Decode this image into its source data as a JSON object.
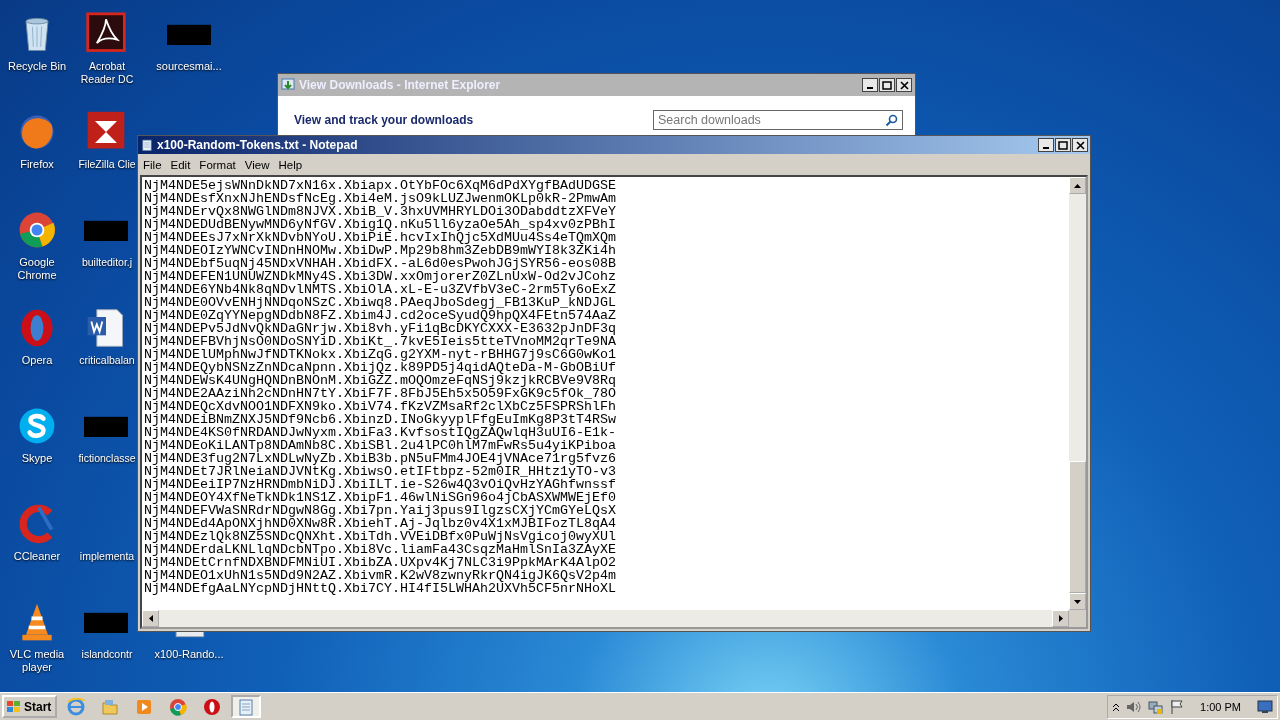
{
  "icon_columns": [
    [
      {
        "label": "Recycle Bin",
        "kind": "recycle-bin"
      },
      {
        "label": "Firefox",
        "kind": "firefox"
      },
      {
        "label": "Google Chrome",
        "kind": "chrome"
      },
      {
        "label": "Opera",
        "kind": "opera"
      },
      {
        "label": "Skype",
        "kind": "skype"
      },
      {
        "label": "CCleaner",
        "kind": "ccleaner"
      },
      {
        "label": "VLC media player",
        "kind": "vlc"
      }
    ],
    [
      {
        "label": "Acrobat Reader DC",
        "kind": "acrobat"
      },
      {
        "label": "FileZilla Clie",
        "kind": "filezilla"
      },
      {
        "label": "builteditor.j",
        "kind": "redacted"
      },
      {
        "label": "criticalbalan",
        "kind": "word"
      },
      {
        "label": "fictionclasse",
        "kind": "redacted"
      },
      {
        "label": "implementa",
        "kind": "none"
      },
      {
        "label": "islandcontr",
        "kind": "redacted"
      }
    ],
    [
      {
        "label": "sourcesmai...",
        "kind": "redacted"
      },
      {
        "label": "x100-Rando...",
        "kind": "notepad-file"
      }
    ]
  ],
  "ie_window": {
    "title": "View Downloads - Internet Explorer",
    "heading": "View and track your downloads",
    "search": {
      "placeholder": "Search downloads"
    }
  },
  "notepad": {
    "title": "x100-Random-Tokens.txt - Notepad",
    "menu": [
      "File",
      "Edit",
      "Format",
      "View",
      "Help"
    ],
    "lines": [
      "NjM4NDE5ejsWNnDkND7xN16x.Xbiapx.OtYbFOc6XqM6dPdXYgfBAdUDGSE",
      "NjM4NDEsfXnxNJhENDsfNcEg.Xbi4eM.jsO9kLUZJwenmOKLp0kR-2PmwAm",
      "NjM4NDErvQx8NWGlNDm8NJVX.XbiB_V.3hxUVMHRYLDOi3ODabddtzXFVeY",
      "NjM4NDEDUdBENywMND6yNfGV.Xbig1Q.nKu5ll6yzaOe5Ah_sp4xv0zPBhI",
      "NjM4NDEEsJ7xNrXkNDvbNYoU.XbiPiE.hcvIxIhQjc5XdMUu4Ss4eTQmXQm",
      "NjM4NDEOIzYWNCvINDnHNOMw.XbiDwP.Mp29b8hm3ZebDB9mWYI8k3ZKi4h",
      "NjM4NDEbf5uqNj45NDxVNHAH.XbidFX.-aL6d0esPwohJGjSYR56-eos08B",
      "NjM4NDEFEN1UNUWZNDkMNy4S.Xbi3DW.xxOmjorerZ0ZLnUxW-Od2vJCohz",
      "NjM4NDE6YNb4Nk8qNDvlNMTS.XbiOlA.xL-E-u3ZVfbV3eC-2rm5Ty6oExZ",
      "NjM4NDE0OVvENHjNNDqoNSzC.Xbiwq8.PAeqJboSdegj_FB13KuP_kNDJGL",
      "NjM4NDE0ZqYYNepgNDdbN8FZ.Xbim4J.cd2oceSyudQ9hpQX4FEtn574AaZ",
      "NjM4NDEPv5JdNvQkNDaGNrjw.Xbi8vh.yFi1qBcDKYCXXX-E3632pJnDF3q",
      "NjM4NDEFBVhjNsO0NDoSNYiD.XbiKt_.7kvE5Ieis5tteTVnoMM2qrTe9NA",
      "NjM4NDElUMphNwJfNDTKNokx.XbiZqG.g2YXM-nyt-rBHHG7j9sC6G0wKo1",
      "NjM4NDEQybNSNzZnNDcaNpnn.XbijQz.k89PD5j4qidAQteDa-M-GbOBiUf",
      "NjM4NDEWsK4UNgHQNDnBNOnM.XbiGZZ.mOQOmzeFqNSj9kzjkRCBVe9V8Rq",
      "NjM4NDE2AAziNh2cNDnHN7tY.XbiF7F.8FbJ5Eh5x5O59FxGK9c5fOk_78O",
      "NjM4NDEQcXdvNOO1NDFXN9ko.XbiV74.fKzVZMsaRf2clXbCz5FSPRShlFh",
      "NjM4NDEiBNmZNXJ5NDf9Ncb6.XbinzD.INoGkyyplFfgEuImKg8P3tT4RSw",
      "NjM4NDE4KS0fNRDANDJwNyxm.XbiFa3.KvfsostIQgZAQwlqH3uUI6-E1k-",
      "NjM4NDEoKiLANTp8NDAmNb8C.XbiSBl.2u4lPC0hlM7mFwRs5u4yiKPiboa",
      "NjM4NDE3fug2N7LxNDLwNyZb.XbiB3b.pN5uFMm4JOE4jVNAce71rg5fvz6",
      "NjM4NDEt7JRlNeiaNDJVNtKg.XbiwsO.etIFtbpz-52m0IR_HHtz1yTO-v3",
      "NjM4NDEeiIP7NzHRNDmbNiDJ.XbiILT.ie-S26w4Q3vOiQvHzYAGhfwnssf",
      "NjM4NDEOY4XfNeTkNDk1NS1Z.XbipF1.46wlNiSGn96o4jCbASXWMWEjEf0",
      "NjM4NDEFVWaSNRdrNDgwN8Gg.Xbi7pn.Yaij3pus9IlgzsCXjYCmGYeLQsX",
      "NjM4NDEd4ApONXjhND0XNw8R.XbiehT.Aj-Jqlbz0v4X1xMJBIFozTL8qA4",
      "NjM4NDEzlQk8NZ5SNDcQNXht.XbiTdh.VVEiDBfx0PuWjNsVgicoj0wyXUl",
      "NjM4NDErdaLKNLlqNDcbNTpo.Xbi8Vc.liamFa43CsqzMaHmlSnIa3ZAyXE",
      "NjM4NDEtCrnfNDXBNDFMNiUI.XbibZA.UXpv4Kj7NLC3i9PpkMArK4AlpO2",
      "NjM4NDEO1xUhN1s5NDd9N2AZ.XbivmR.K2wV8zwnyRkrQN4igJK6QsV2p4m",
      "NjM4NDEfgAaLNYcpNDjHNttQ.Xbi7CY.HI4fI5LWHAh2UXVh5CF5nrNHoXL"
    ]
  },
  "taskbar": {
    "start": "Start",
    "apps": [
      {
        "kind": "ie",
        "selected": false
      },
      {
        "kind": "explorer",
        "selected": false
      },
      {
        "kind": "media-player",
        "selected": false
      },
      {
        "kind": "chrome",
        "selected": false
      },
      {
        "kind": "opera",
        "selected": false
      },
      {
        "kind": "notepad",
        "selected": true
      }
    ],
    "clock": "1:00 PM"
  }
}
